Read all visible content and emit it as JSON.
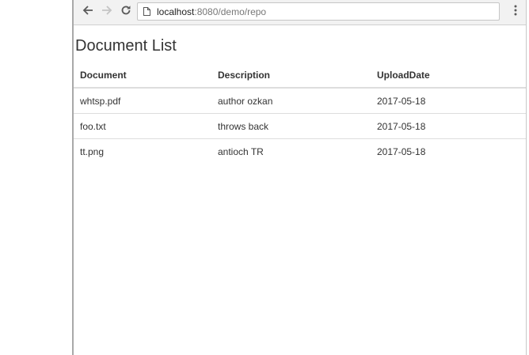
{
  "browser": {
    "url_host": "localhost",
    "url_rest": ":8080/demo/repo",
    "icons": {
      "back": "arrow-left",
      "forward": "arrow-right",
      "reload": "reload",
      "page": "document",
      "menu": "vertical-dots"
    }
  },
  "page": {
    "title": "Document List",
    "table": {
      "headers": [
        "Document",
        "Description",
        "UploadDate"
      ],
      "rows": [
        [
          "whtsp.pdf",
          "author ozkan",
          "2017-05-18"
        ],
        [
          "foo.txt",
          "throws back",
          "2017-05-18"
        ],
        [
          "tt.png",
          "antioch TR",
          "2017-05-18"
        ]
      ]
    }
  }
}
